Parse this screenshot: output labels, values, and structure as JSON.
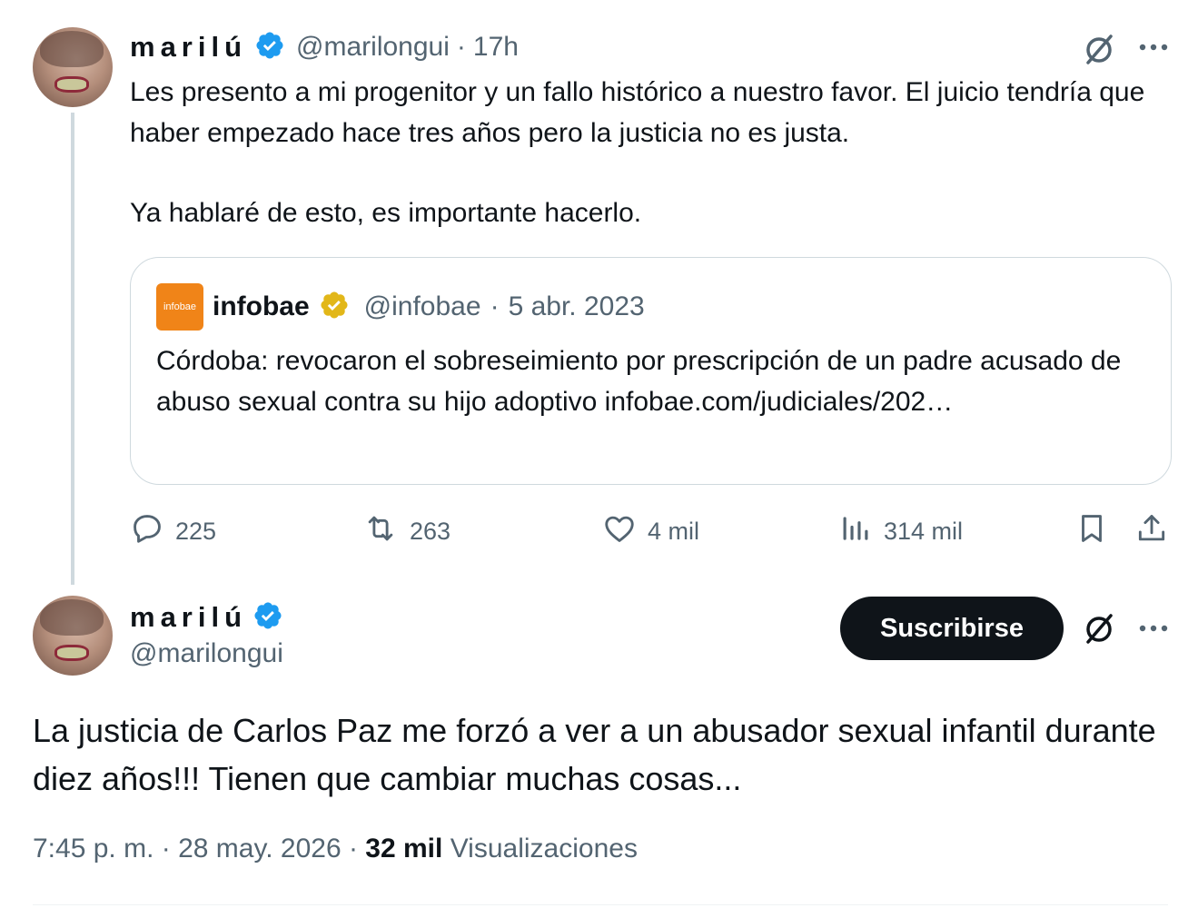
{
  "tweet1": {
    "display_name": "marilú",
    "handle": "@marilongui",
    "separator": "·",
    "time": "17h",
    "text_paragraphs": [
      "Les presento a mi progenitor y un fallo histórico a nuestro favor. El juicio tendría que haber empezado hace tres años pero la justicia no es justa.",
      "Ya hablaré de esto, es importante hacerlo."
    ],
    "quote": {
      "logo_text": "infobae",
      "display_name": "infobae",
      "handle": "@infobae",
      "separator": "·",
      "date": "5 abr. 2023",
      "text": "Córdoba: revocaron el sobreseimiento por prescripción de un padre acusado de abuso sexual contra su hijo adoptivo infobae.com/judiciales/202…"
    },
    "actions": {
      "replies": "225",
      "reposts": "263",
      "likes": "4 mil",
      "views": "314 mil"
    }
  },
  "tweet2": {
    "display_name": "marilú",
    "handle": "@marilongui",
    "subscribe_label": "Suscribirse",
    "text": "La justicia de Carlos Paz me forzó a ver a un abusador sexual infantil durante diez años!!! Tienen que cambiar muchas cosas...",
    "meta": {
      "time_date": "7:45 p. m. · 28 may. 2026 ·",
      "views_count": "32 mil",
      "views_label": "Visualizaciones"
    }
  },
  "colors": {
    "verified_blue": "#1d9bf0",
    "verified_gold": "#e2b719",
    "text_primary": "#0f1419",
    "text_secondary": "#536471",
    "border": "#cfd9de",
    "infobae_orange": "#f08418"
  },
  "icons": [
    "grok-icon",
    "more-icon",
    "reply-icon",
    "repost-icon",
    "like-icon",
    "views-icon",
    "bookmark-icon",
    "share-icon",
    "verified-badge-icon"
  ]
}
